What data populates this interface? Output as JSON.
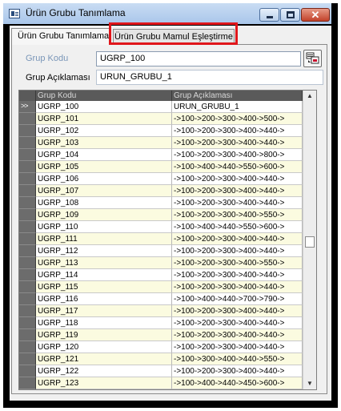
{
  "window": {
    "title": "Ürün Grubu Tanımlama"
  },
  "tabs": [
    {
      "label": "Ürün Grubu Tanımlama"
    },
    {
      "label": "Ürün Grubu Mamul Eşleştirme"
    }
  ],
  "form": {
    "grup_kodu_label": "Grup Kodu",
    "grup_kodu_value": "UGRP_100",
    "grup_aciklamasi_label": "Grup Açıklaması",
    "grup_aciklamasi_value": "URUN_GRUBU_1"
  },
  "grid": {
    "columns": [
      "Grup Kodu",
      "Grup Açıklaması"
    ],
    "current_indicator": ">>",
    "rows": [
      {
        "kod": "UGRP_100",
        "aciklama": "URUN_GRUBU_1"
      },
      {
        "kod": "UGRP_101",
        "aciklama": "->100->200->300->400->500->"
      },
      {
        "kod": "UGRP_102",
        "aciklama": "->100->200->300->400->440->"
      },
      {
        "kod": "UGRP_103",
        "aciklama": "->100->200->300->400->440->"
      },
      {
        "kod": "UGRP_104",
        "aciklama": "->100->200->300->400->800->"
      },
      {
        "kod": "UGRP_105",
        "aciklama": "->100->400->440->550->600->"
      },
      {
        "kod": "UGRP_106",
        "aciklama": "->100->200->300->400->440->"
      },
      {
        "kod": "UGRP_107",
        "aciklama": "->100->200->300->400->440->"
      },
      {
        "kod": "UGRP_108",
        "aciklama": "->100->200->300->400->440->"
      },
      {
        "kod": "UGRP_109",
        "aciklama": "->100->200->300->400->550->"
      },
      {
        "kod": "UGRP_110",
        "aciklama": "->100->400->440->550->600->"
      },
      {
        "kod": "UGRP_111",
        "aciklama": "->100->200->300->400->440->"
      },
      {
        "kod": "UGRP_112",
        "aciklama": "->100->200->300->400->440->"
      },
      {
        "kod": "UGRP_113",
        "aciklama": "->100->200->300->400->550->"
      },
      {
        "kod": "UGRP_114",
        "aciklama": "->100->200->300->400->440->"
      },
      {
        "kod": "UGRP_115",
        "aciklama": "->100->200->300->400->440->"
      },
      {
        "kod": "UGRP_116",
        "aciklama": "->100->400->440->700->790->"
      },
      {
        "kod": "UGRP_117",
        "aciklama": "->100->200->300->400->440->"
      },
      {
        "kod": "UGRP_118",
        "aciklama": "->100->200->300->400->440->"
      },
      {
        "kod": "UGRP_119",
        "aciklama": "->100->200->300->400->440->"
      },
      {
        "kod": "UGRP_120",
        "aciklama": "->100->200->300->400->440->"
      },
      {
        "kod": "UGRP_121",
        "aciklama": "->100->300->400->440->550->"
      },
      {
        "kod": "UGRP_122",
        "aciklama": "->100->200->300->400->440->"
      },
      {
        "kod": "UGRP_123",
        "aciklama": "->100->400->440->450->600->"
      }
    ]
  },
  "icons": {
    "app": "window-icon",
    "minimize": "minimize-icon",
    "maximize": "maximize-icon",
    "close": "close-icon",
    "lookup": "lookup-search-icon",
    "scroll_up": "scroll-up-arrow-icon",
    "scroll_down": "scroll-down-arrow-icon"
  },
  "colors": {
    "highlight_border": "#e0161b",
    "grid_header_bg": "#5a5a5a",
    "odd_row_bg": "#fbfbe0",
    "disabled_label": "#7a96b8"
  }
}
